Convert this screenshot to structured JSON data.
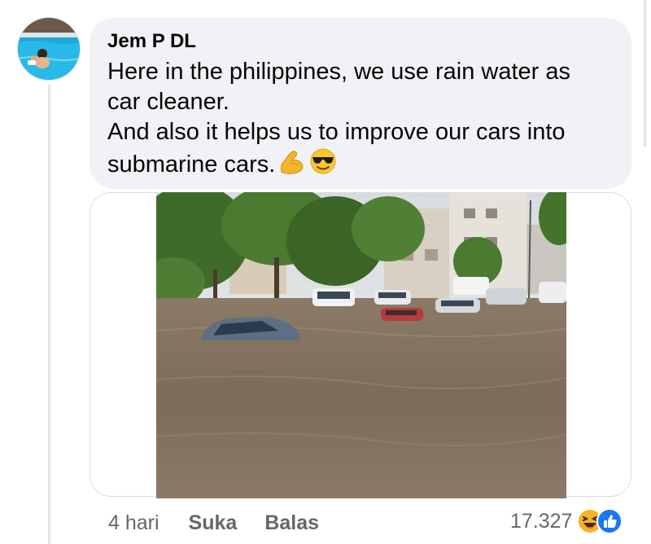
{
  "comment": {
    "author": "Jem P DL",
    "text_lines": [
      "Here in the philippines, we use rain water as",
      "car cleaner.",
      "And also it helps us to improve our cars into",
      "submarine cars."
    ],
    "emojis": [
      "flexed-biceps-icon",
      "smiling-face-with-sunglasses-icon"
    ]
  },
  "footer": {
    "time": "4 hari",
    "like_label": "Suka",
    "reply_label": "Balas",
    "reaction_count": "17.327",
    "reaction_icons": [
      "laughing-reaction-icon",
      "like-reaction-icon"
    ]
  },
  "colors": {
    "bubble_bg": "#f0f2f5",
    "meta_text": "#65676b",
    "like_blue": "#1877f2",
    "haha_yellow": "#f7b125"
  }
}
